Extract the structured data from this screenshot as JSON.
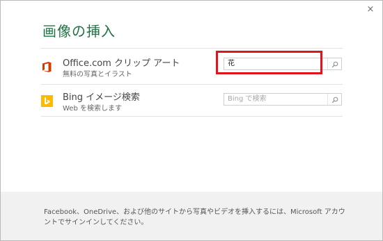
{
  "dialog": {
    "title": "画像の挿入",
    "close_label": "×"
  },
  "sources": [
    {
      "name": "Office.com クリップ アート",
      "subtitle": "無料の写真とイラスト",
      "icon": "office-icon",
      "search_value": "花",
      "search_placeholder": ""
    },
    {
      "name": "Bing イメージ検索",
      "subtitle": "Web を検索します",
      "icon": "bing-icon",
      "search_value": "",
      "search_placeholder": "Bing で検索"
    }
  ],
  "footer": {
    "text": "Facebook、OneDrive、および他のサイトから写真やビデオを挿入するには、Microsoft アカウントでサインインしてください。"
  },
  "colors": {
    "title": "#217346",
    "office_icon": "#d83b01",
    "bing_icon": "#ffb900",
    "highlight": "#e1141c"
  }
}
